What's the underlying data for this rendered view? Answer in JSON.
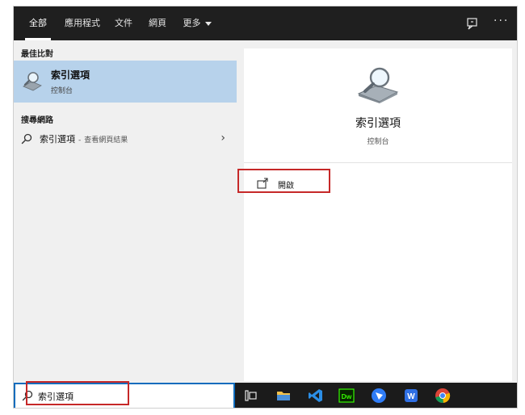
{
  "tabs": [
    {
      "label": "全部",
      "active": true
    },
    {
      "label": "應用程式",
      "active": false
    },
    {
      "label": "文件",
      "active": false
    },
    {
      "label": "網頁",
      "active": false
    },
    {
      "label": "更多",
      "active": false
    }
  ],
  "left": {
    "best_match_header": "最佳比對",
    "best_match": {
      "title": "索引選項",
      "subtitle": "控制台"
    },
    "web_header": "搜尋網路",
    "web_result": {
      "query": "索引選項",
      "separator": "-",
      "hint": "查看網頁結果"
    }
  },
  "right": {
    "title": "索引選項",
    "subtitle": "控制台",
    "open_label": "開啟"
  },
  "taskbar": {
    "search_value": "索引選項",
    "apps": [
      "task-view-icon",
      "file-explorer-icon",
      "vscode-icon",
      "dreamweaver-icon",
      "feishu-icon",
      "wps-icon",
      "chrome-icon"
    ],
    "dw_text": "Dw",
    "wps_text": "W"
  },
  "colors": {
    "accent": "#0f6cbd",
    "highlight_box": "#c62828",
    "selected_row": "#b7d2eb",
    "topbar": "#1f1f1f"
  }
}
